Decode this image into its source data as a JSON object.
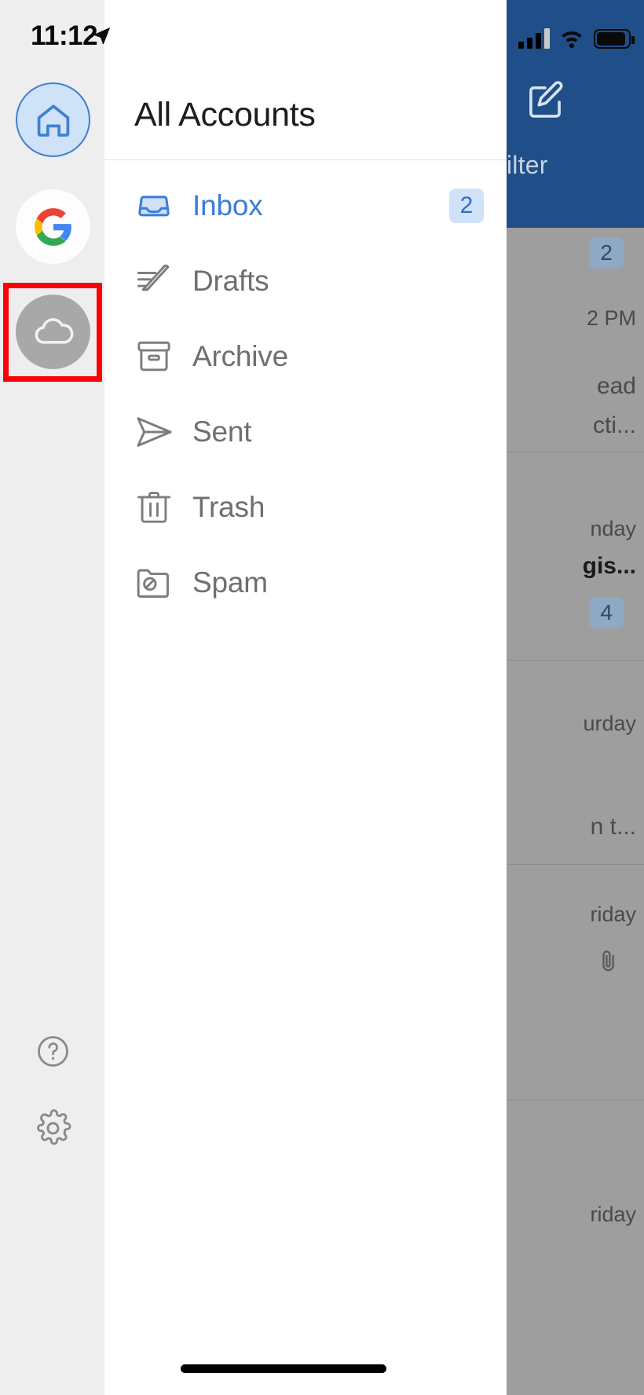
{
  "status_bar": {
    "time": "11:12",
    "location_icon": "location-arrow-icon",
    "signal_icon": "cellular-signal-icon",
    "wifi_icon": "wifi-icon",
    "battery_icon": "battery-icon"
  },
  "account_rail": {
    "accounts": [
      {
        "name": "home-account",
        "icon": "home-icon",
        "selected": false
      },
      {
        "name": "google-account",
        "icon": "google-logo-icon",
        "selected": false
      },
      {
        "name": "icloud-account",
        "icon": "cloud-icon",
        "selected": true,
        "highlighted": true
      }
    ],
    "highlight_color": "#fb0007",
    "help_icon": "question-mark-circle-icon",
    "settings_icon": "gear-icon"
  },
  "drawer": {
    "title": "All Accounts",
    "folders": [
      {
        "label": "Inbox",
        "icon": "inbox-tray-icon",
        "badge": "2",
        "active": true
      },
      {
        "label": "Drafts",
        "icon": "pencil-lines-icon",
        "badge": null,
        "active": false
      },
      {
        "label": "Archive",
        "icon": "archive-box-icon",
        "badge": null,
        "active": false
      },
      {
        "label": "Sent",
        "icon": "paper-plane-icon",
        "badge": null,
        "active": false
      },
      {
        "label": "Trash",
        "icon": "trash-can-icon",
        "badge": null,
        "active": false
      },
      {
        "label": "Spam",
        "icon": "folder-blocked-icon",
        "badge": null,
        "active": false
      }
    ],
    "accent_color": "#3a7ddc",
    "badge_bg": "#cfe2f7"
  },
  "background_app": {
    "navbar_color": "#1f4e88",
    "compose_icon": "compose-pencil-square-icon",
    "filter_label": "ilter",
    "list_badge": "2",
    "rows": [
      {
        "date": "2 PM",
        "snippet_line1": "ead",
        "snippet_line2": "cti...",
        "badge": null,
        "attachment": false
      },
      {
        "date": "nday",
        "subject": "gis...",
        "badge": "4",
        "attachment": false
      },
      {
        "date": "urday",
        "snippet_line1": "n t...",
        "badge": null,
        "attachment": false
      },
      {
        "date": "riday",
        "snippet_line1": "",
        "badge": null,
        "attachment": true
      },
      {
        "date": "riday",
        "snippet_line1": "",
        "badge": null,
        "attachment": false
      }
    ]
  },
  "home_indicator": "home-indicator-bar"
}
